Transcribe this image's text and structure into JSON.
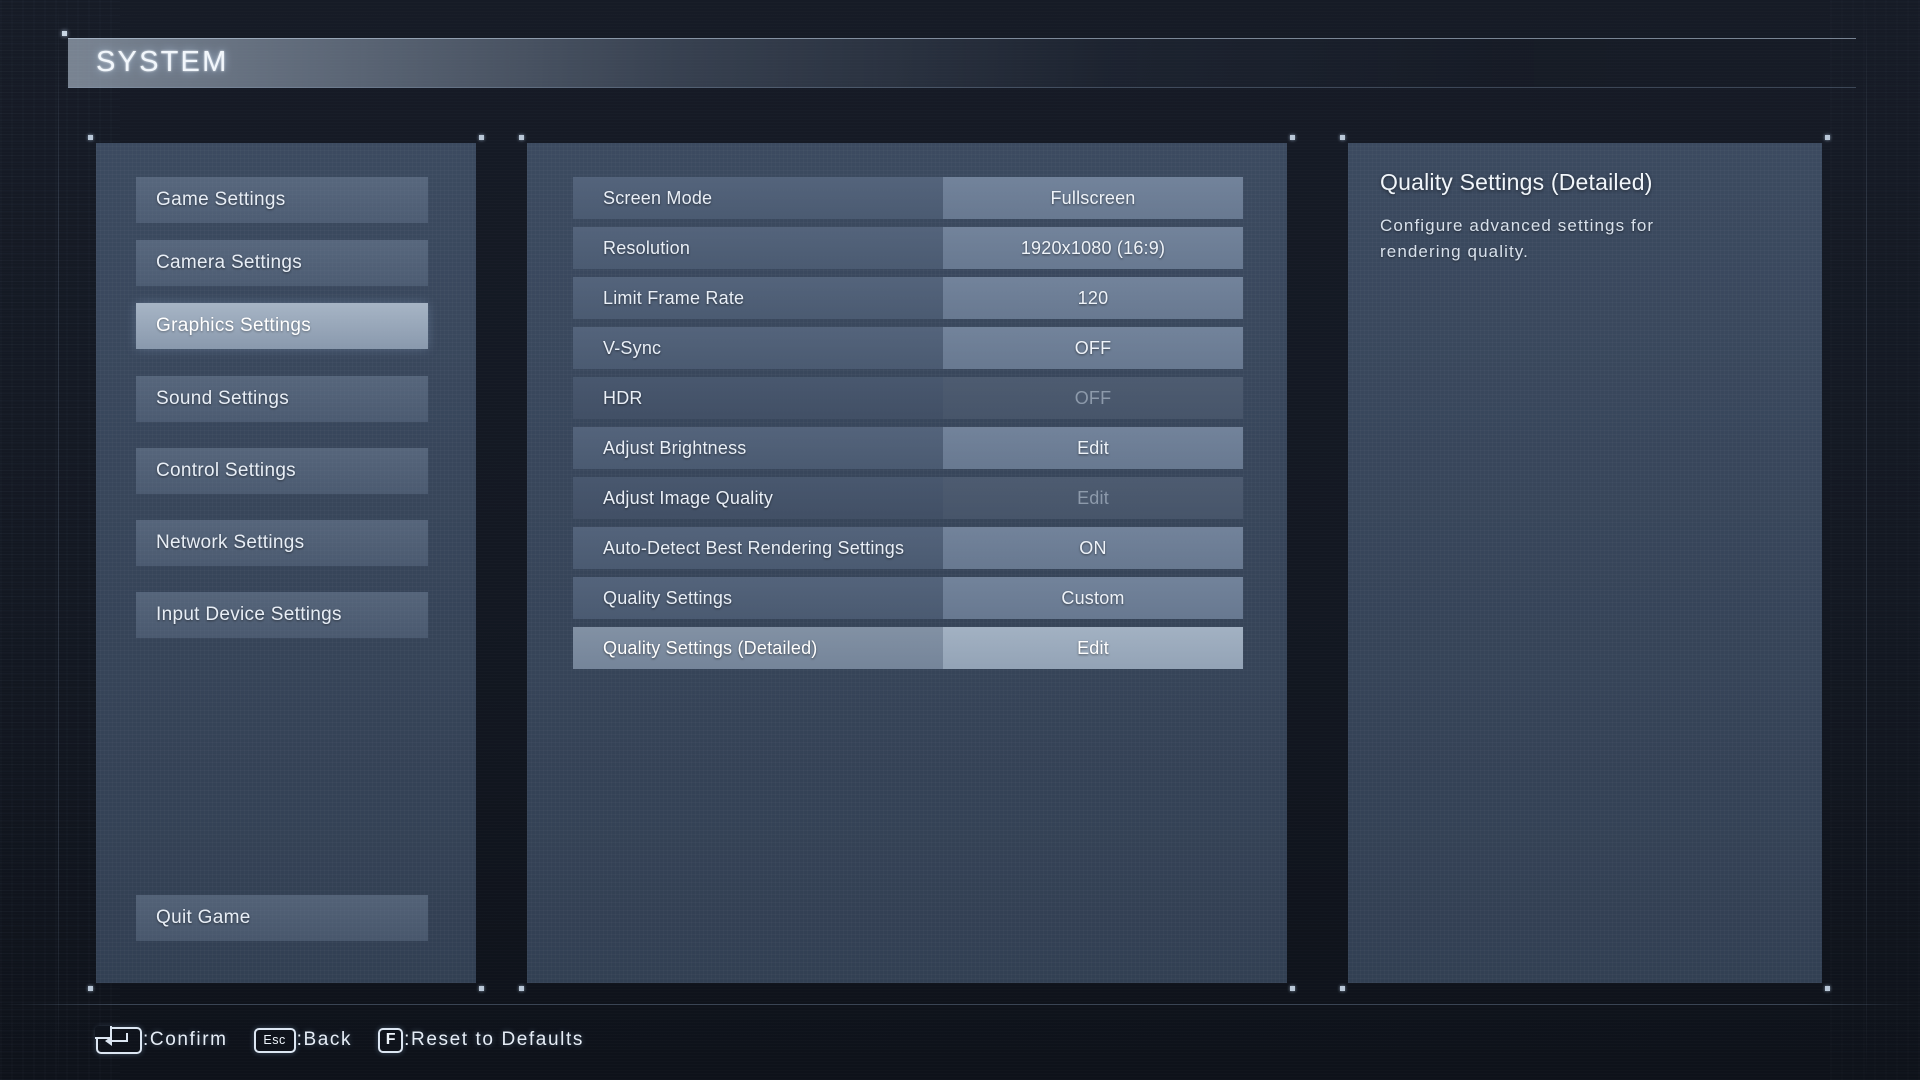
{
  "header": {
    "title": "SYSTEM"
  },
  "sidebar": {
    "items": [
      {
        "label": "Game Settings",
        "selected": false
      },
      {
        "label": "Camera Settings",
        "selected": false
      },
      {
        "label": "Graphics Settings",
        "selected": true
      },
      {
        "label": "Sound Settings",
        "selected": false
      },
      {
        "label": "Control Settings",
        "selected": false
      },
      {
        "label": "Network Settings",
        "selected": false
      },
      {
        "label": "Input Device Settings",
        "selected": false
      }
    ],
    "quit_label": "Quit Game"
  },
  "settings": {
    "rows": [
      {
        "label": "Screen Mode",
        "value": "Fullscreen",
        "state": "normal"
      },
      {
        "label": "Resolution",
        "value": "1920x1080 (16:9)",
        "state": "normal"
      },
      {
        "label": "Limit Frame Rate",
        "value": "120",
        "state": "normal"
      },
      {
        "label": "V-Sync",
        "value": "OFF",
        "state": "normal"
      },
      {
        "label": "HDR",
        "value": "OFF",
        "state": "disabled"
      },
      {
        "label": "Adjust Brightness",
        "value": "Edit",
        "state": "normal"
      },
      {
        "label": "Adjust Image Quality",
        "value": "Edit",
        "state": "disabled"
      },
      {
        "label": "Auto-Detect Best Rendering Settings",
        "value": "ON",
        "state": "normal"
      },
      {
        "label": "Quality Settings",
        "value": "Custom",
        "state": "normal"
      },
      {
        "label": "Quality Settings (Detailed)",
        "value": "Edit",
        "state": "selected"
      }
    ]
  },
  "info": {
    "title": "Quality Settings (Detailed)",
    "description": "Configure advanced settings for rendering quality."
  },
  "footer": {
    "hints": [
      {
        "key_icon": "enter-key-icon",
        "key_label": "",
        "text": ":Confirm"
      },
      {
        "key_icon": "esc-key-icon",
        "key_label": "Esc",
        "text": ":Back"
      },
      {
        "key_icon": "f-key-icon",
        "key_label": "F",
        "text": ":Reset to Defaults"
      }
    ]
  },
  "colors": {
    "background": "#131822",
    "panel": "#3d4c62",
    "row_label": "#56667e",
    "row_value": "#778ca0",
    "selected_row_value": "#a8b7c8",
    "accent_text": "#eef3f9"
  }
}
